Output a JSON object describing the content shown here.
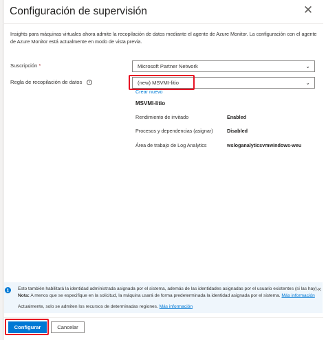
{
  "panel": {
    "title": "Configuración de supervisión",
    "close_glyph": "✕",
    "description": "Insights para máquinas virtuales ahora admite la recopilación de datos mediante el agente de Azure Monitor. La configuración con el agente de Azure Monitor está actualmente en modo de vista previa."
  },
  "subscription": {
    "label": "Suscripción",
    "required_mark": "*",
    "value": "Microsoft Partner Network"
  },
  "data_collection_rule": {
    "label": "Regla de recopilación de datos",
    "info_glyph": "i",
    "value": "(new) MSVMI-litio",
    "create_link": "Crear nuevo"
  },
  "rule_details": {
    "name": "MSVMI-litio",
    "rows": [
      {
        "label": "Rendimiento de invitado",
        "value": "Enabled"
      },
      {
        "label": "Procesos y dependencias (asignar)",
        "value": "Disabled"
      },
      {
        "label": "Área de trabajo de Log Analytics",
        "value": "wsloganalyticsvmwindows-weu"
      }
    ]
  },
  "info_banner": {
    "icon": "info-icon",
    "line1": "Esto también habilitará la identidad administrada asignada por el sistema, además de las identidades asignadas por el usuario existentes (si las hay).",
    "note_label": "Nota:",
    "line2": "A menos que se especifique en la solicitud, la máquina usará de forma predeterminada la identidad asignada por el sistema.",
    "line2_link": "Más información",
    "line3": "Actualmente, solo se admiten los recursos de determinadas regiones.",
    "line3_link": "Más información",
    "close_glyph": "✕"
  },
  "footer": {
    "configure_label": "Configurar",
    "cancel_label": "Cancelar"
  },
  "colors": {
    "accent": "#0078d4",
    "highlight": "#e81123",
    "info_background": "#eff6fc"
  }
}
